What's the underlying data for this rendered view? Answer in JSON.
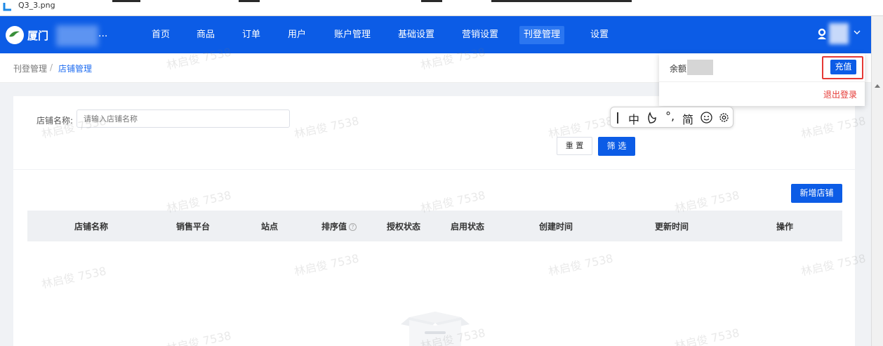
{
  "window": {
    "file_name": "Q3_3.png"
  },
  "brand": {
    "name": "厦门",
    "ellipsis": "..."
  },
  "nav": {
    "items": [
      "首页",
      "商品",
      "订单",
      "用户",
      "账户管理",
      "基础设置",
      "营销设置",
      "刊登管理",
      "设置"
    ],
    "active_index": 7
  },
  "breadcrumb": {
    "parent": "刊登管理",
    "separator": "/",
    "current": "店铺管理"
  },
  "filter": {
    "shop_name_label": "店铺名称:",
    "shop_name_placeholder": "请输入店铺名称",
    "reset_label": "重 置",
    "filter_label": "筛 选"
  },
  "list": {
    "add_button": "新增店铺",
    "columns": [
      "店铺名称",
      "销售平台",
      "站点",
      "排序值",
      "授权状态",
      "启用状态",
      "创建时间",
      "更新时间",
      "操作"
    ],
    "help_icon_char": "?",
    "rows": []
  },
  "user_menu": {
    "balance_label": "余额",
    "recharge_label": "充值",
    "logout_label": "退出登录"
  },
  "ime": {
    "mode": "中",
    "punct": "°,",
    "script": "简"
  },
  "watermark": "林启俊 7538",
  "colors": {
    "primary": "#0c5ce6",
    "danger": "#e53935",
    "table_header": "#eef0f3"
  }
}
